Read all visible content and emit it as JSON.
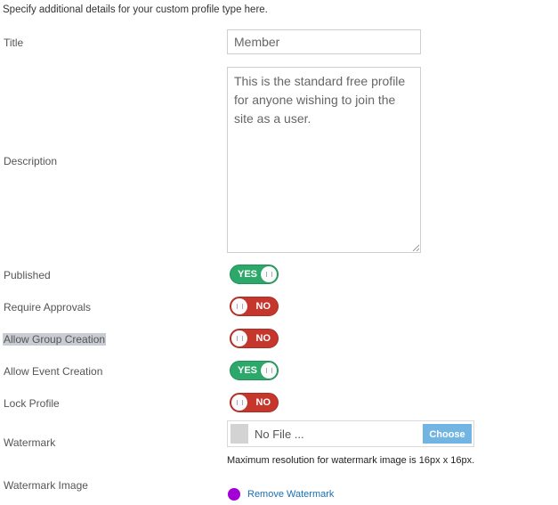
{
  "intro": "Specify additional details for your custom profile type here.",
  "fields": {
    "title": {
      "label": "Title",
      "value": "Member"
    },
    "description": {
      "label": "Description",
      "value": "This is the standard free profile for anyone wishing to join the site as a user."
    },
    "published": {
      "label": "Published",
      "state": "YES"
    },
    "require_approvals": {
      "label": "Require Approvals",
      "state": "NO"
    },
    "allow_group_creation": {
      "label": "Allow Group Creation",
      "state": "NO"
    },
    "allow_event_creation": {
      "label": "Allow Event Creation",
      "state": "YES"
    },
    "lock_profile": {
      "label": "Lock Profile",
      "state": "NO"
    },
    "watermark": {
      "label": "Watermark",
      "file_name": "No File ...",
      "choose_label": "Choose",
      "hint": "Maximum resolution for watermark image is 16px x 16px."
    },
    "watermark_image": {
      "label": "Watermark Image",
      "remove_label": "Remove Watermark",
      "swatch_color": "#a200d6"
    }
  },
  "colors": {
    "toggle_on": "#2ca86a",
    "toggle_off": "#c5372c",
    "choose_button": "#72b5e3",
    "link": "#1a6fb3"
  }
}
